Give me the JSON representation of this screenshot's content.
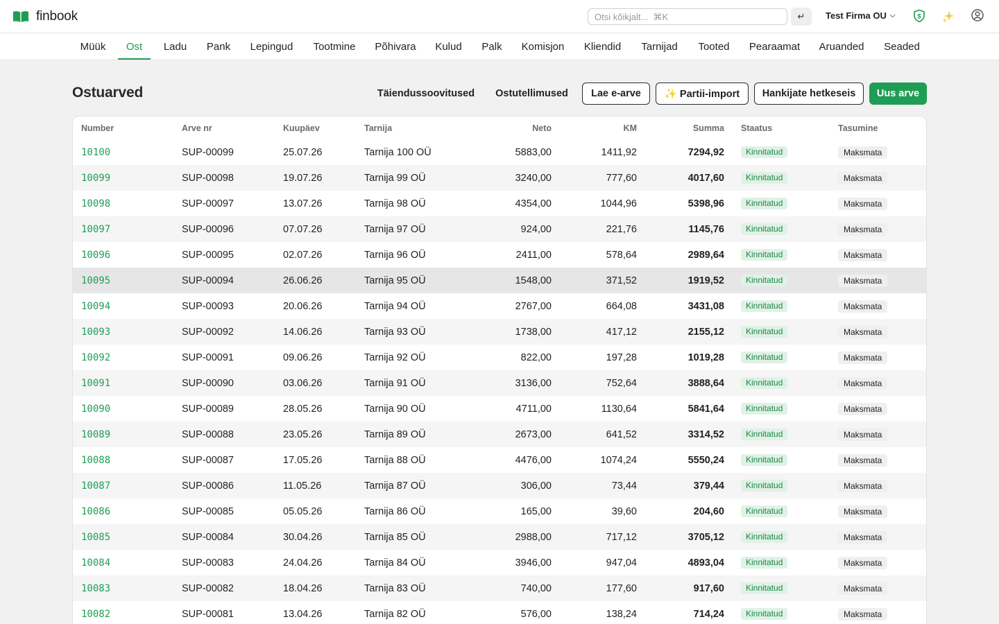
{
  "app": {
    "name": "finbook"
  },
  "search": {
    "placeholder": "Otsi kõikjalt...  ⌘K",
    "enter_label": "↵"
  },
  "company": {
    "name": "Test Firma OU",
    "chevron": "⌵"
  },
  "nav": {
    "items": [
      "Müük",
      "Ost",
      "Ladu",
      "Pank",
      "Lepingud",
      "Tootmine",
      "Põhivara",
      "Kulud",
      "Palk",
      "Komisjon",
      "Kliendid",
      "Tarnijad",
      "Tooted",
      "Pearaamat",
      "Aruanded",
      "Seaded"
    ],
    "active": "Ost"
  },
  "page": {
    "title": "Ostuarved",
    "actions": {
      "suggestions": "Täiendussoovitused",
      "orders": "Ostutellimused",
      "load_einvoice": "Lae e-arve",
      "batch_import": "✨ Partii-import",
      "supplier_snapshot": "Hankijate hetkeseis",
      "new_invoice": "Uus arve"
    }
  },
  "table": {
    "headers": {
      "number": "Number",
      "invoice_no": "Arve nr",
      "date": "Kuupäev",
      "supplier": "Tarnija",
      "net": "Neto",
      "vat": "KM",
      "total": "Summa",
      "status": "Staatus",
      "payment": "Tasumine"
    },
    "rows": [
      {
        "number": "10100",
        "invoice_no": "SUP-00099",
        "date": "25.07.26",
        "supplier": "Tarnija 100 OÜ",
        "net": "5883,00",
        "vat": "1411,92",
        "total": "7294,92",
        "status": "Kinnitatud",
        "payment": "Maksmata"
      },
      {
        "number": "10099",
        "invoice_no": "SUP-00098",
        "date": "19.07.26",
        "supplier": "Tarnija 99 OÜ",
        "net": "3240,00",
        "vat": "777,60",
        "total": "4017,60",
        "status": "Kinnitatud",
        "payment": "Maksmata"
      },
      {
        "number": "10098",
        "invoice_no": "SUP-00097",
        "date": "13.07.26",
        "supplier": "Tarnija 98 OÜ",
        "net": "4354,00",
        "vat": "1044,96",
        "total": "5398,96",
        "status": "Kinnitatud",
        "payment": "Maksmata"
      },
      {
        "number": "10097",
        "invoice_no": "SUP-00096",
        "date": "07.07.26",
        "supplier": "Tarnija 97 OÜ",
        "net": "924,00",
        "vat": "221,76",
        "total": "1145,76",
        "status": "Kinnitatud",
        "payment": "Maksmata"
      },
      {
        "number": "10096",
        "invoice_no": "SUP-00095",
        "date": "02.07.26",
        "supplier": "Tarnija 96 OÜ",
        "net": "2411,00",
        "vat": "578,64",
        "total": "2989,64",
        "status": "Kinnitatud",
        "payment": "Maksmata"
      },
      {
        "number": "10095",
        "invoice_no": "SUP-00094",
        "date": "26.06.26",
        "supplier": "Tarnija 95 OÜ",
        "net": "1548,00",
        "vat": "371,52",
        "total": "1919,52",
        "status": "Kinnitatud",
        "payment": "Maksmata"
      },
      {
        "number": "10094",
        "invoice_no": "SUP-00093",
        "date": "20.06.26",
        "supplier": "Tarnija 94 OÜ",
        "net": "2767,00",
        "vat": "664,08",
        "total": "3431,08",
        "status": "Kinnitatud",
        "payment": "Maksmata"
      },
      {
        "number": "10093",
        "invoice_no": "SUP-00092",
        "date": "14.06.26",
        "supplier": "Tarnija 93 OÜ",
        "net": "1738,00",
        "vat": "417,12",
        "total": "2155,12",
        "status": "Kinnitatud",
        "payment": "Maksmata"
      },
      {
        "number": "10092",
        "invoice_no": "SUP-00091",
        "date": "09.06.26",
        "supplier": "Tarnija 92 OÜ",
        "net": "822,00",
        "vat": "197,28",
        "total": "1019,28",
        "status": "Kinnitatud",
        "payment": "Maksmata"
      },
      {
        "number": "10091",
        "invoice_no": "SUP-00090",
        "date": "03.06.26",
        "supplier": "Tarnija 91 OÜ",
        "net": "3136,00",
        "vat": "752,64",
        "total": "3888,64",
        "status": "Kinnitatud",
        "payment": "Maksmata"
      },
      {
        "number": "10090",
        "invoice_no": "SUP-00089",
        "date": "28.05.26",
        "supplier": "Tarnija 90 OÜ",
        "net": "4711,00",
        "vat": "1130,64",
        "total": "5841,64",
        "status": "Kinnitatud",
        "payment": "Maksmata"
      },
      {
        "number": "10089",
        "invoice_no": "SUP-00088",
        "date": "23.05.26",
        "supplier": "Tarnija 89 OÜ",
        "net": "2673,00",
        "vat": "641,52",
        "total": "3314,52",
        "status": "Kinnitatud",
        "payment": "Maksmata"
      },
      {
        "number": "10088",
        "invoice_no": "SUP-00087",
        "date": "17.05.26",
        "supplier": "Tarnija 88 OÜ",
        "net": "4476,00",
        "vat": "1074,24",
        "total": "5550,24",
        "status": "Kinnitatud",
        "payment": "Maksmata"
      },
      {
        "number": "10087",
        "invoice_no": "SUP-00086",
        "date": "11.05.26",
        "supplier": "Tarnija 87 OÜ",
        "net": "306,00",
        "vat": "73,44",
        "total": "379,44",
        "status": "Kinnitatud",
        "payment": "Maksmata"
      },
      {
        "number": "10086",
        "invoice_no": "SUP-00085",
        "date": "05.05.26",
        "supplier": "Tarnija 86 OÜ",
        "net": "165,00",
        "vat": "39,60",
        "total": "204,60",
        "status": "Kinnitatud",
        "payment": "Maksmata"
      },
      {
        "number": "10085",
        "invoice_no": "SUP-00084",
        "date": "30.04.26",
        "supplier": "Tarnija 85 OÜ",
        "net": "2988,00",
        "vat": "717,12",
        "total": "3705,12",
        "status": "Kinnitatud",
        "payment": "Maksmata"
      },
      {
        "number": "10084",
        "invoice_no": "SUP-00083",
        "date": "24.04.26",
        "supplier": "Tarnija 84 OÜ",
        "net": "3946,00",
        "vat": "947,04",
        "total": "4893,04",
        "status": "Kinnitatud",
        "payment": "Maksmata"
      },
      {
        "number": "10083",
        "invoice_no": "SUP-00082",
        "date": "18.04.26",
        "supplier": "Tarnija 83 OÜ",
        "net": "740,00",
        "vat": "177,60",
        "total": "917,60",
        "status": "Kinnitatud",
        "payment": "Maksmata"
      },
      {
        "number": "10082",
        "invoice_no": "SUP-00081",
        "date": "13.04.26",
        "supplier": "Tarnija 82 OÜ",
        "net": "576,00",
        "vat": "138,24",
        "total": "714,24",
        "status": "Kinnitatud",
        "payment": "Maksmata"
      }
    ],
    "highlighted_row": "10095"
  },
  "icons": {
    "logo": "open-book-icon",
    "shield": "shield-dollar-icon",
    "sparkles": "sparkles-icon",
    "user": "user-circle-icon"
  },
  "colors": {
    "brand_green": "#1f9d55",
    "status_bg": "#dff2e5",
    "status_text": "#1e8449",
    "page_bg": "#f1f1f1",
    "row_stripe": "#f5f5f5",
    "row_highlight": "#e6e6e6",
    "sparkle": "#f2c94c"
  }
}
